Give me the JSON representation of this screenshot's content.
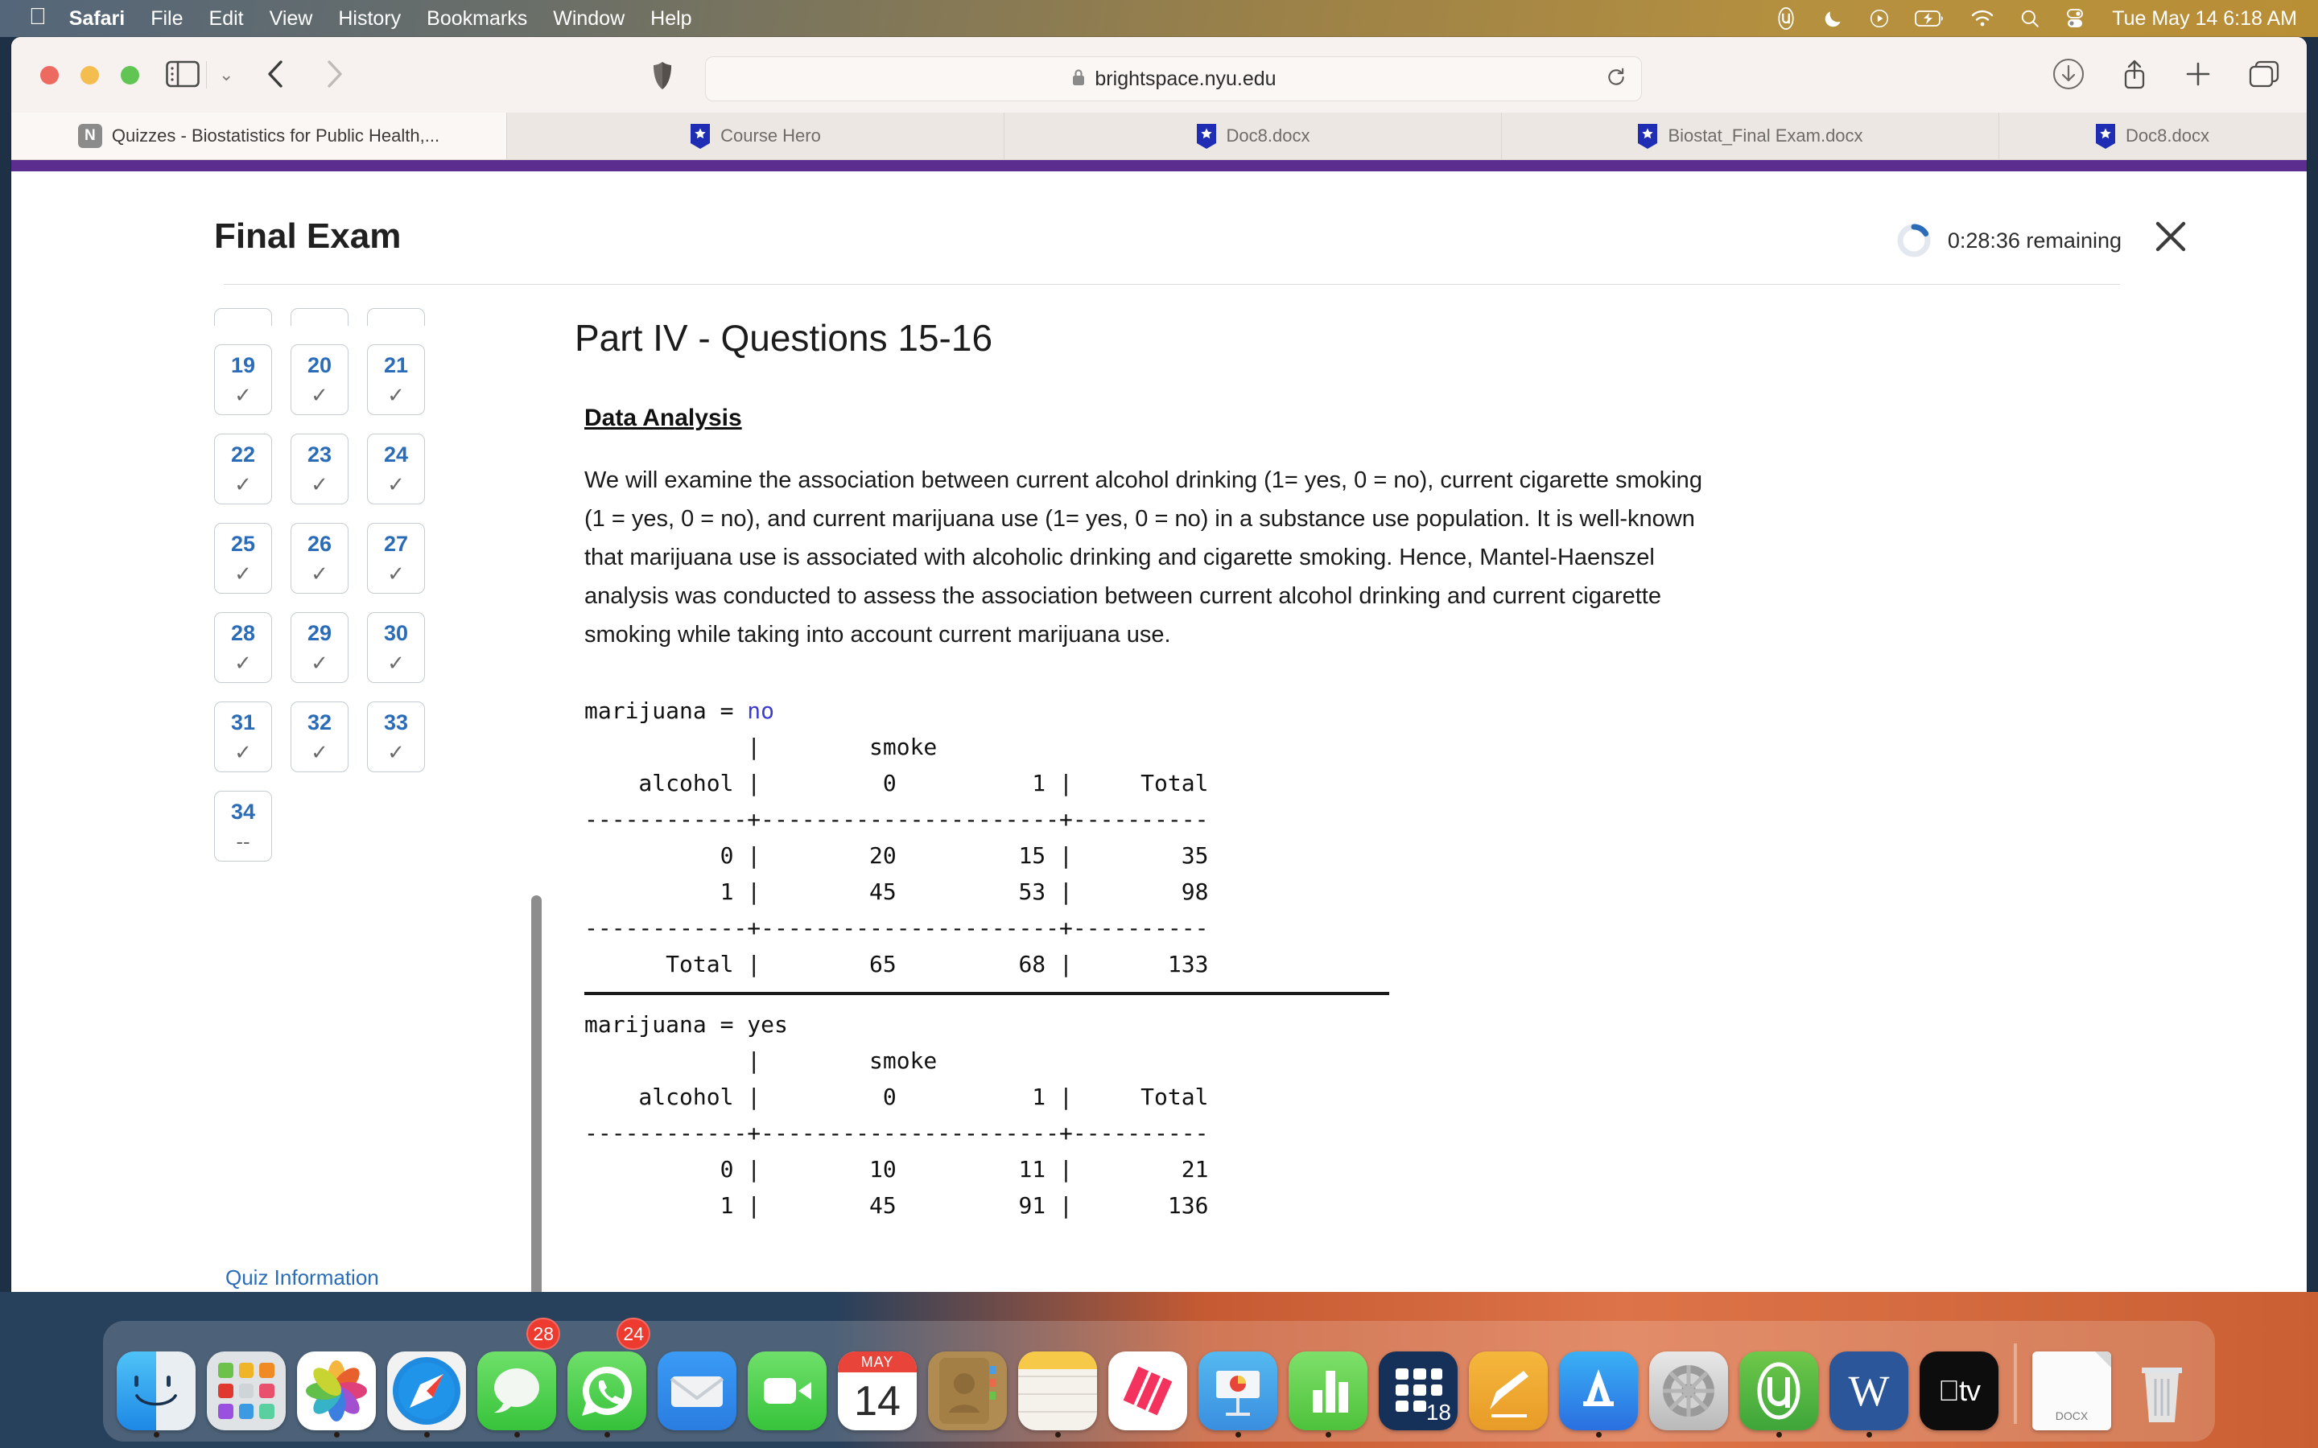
{
  "menubar": {
    "apple": "",
    "items": [
      "Safari",
      "File",
      "Edit",
      "View",
      "History",
      "Bookmarks",
      "Window",
      "Help"
    ],
    "status_icons": [
      "utorrent-icon",
      "moon-icon",
      "play-circle-icon",
      "battery-charging-icon",
      "wifi-icon",
      "search-icon",
      "control-center-icon"
    ],
    "clock": "Tue May 14  6:18 AM"
  },
  "browser": {
    "url": "brightspace.nyu.edu",
    "toolbar_icons": [
      "sidebar-icon",
      "chevron-down-icon",
      "back-icon",
      "forward-icon",
      "shield-icon",
      "lock-icon",
      "reload-icon",
      "download-icon",
      "share-icon",
      "new-tab-icon",
      "tab-overview-icon"
    ],
    "tabs": [
      {
        "label": "Quizzes - Biostatistics for Public Health,...",
        "favicon": "nyu-icon",
        "active": true
      },
      {
        "label": "Course Hero",
        "favicon": "coursehero-icon",
        "active": false
      },
      {
        "label": "Doc8.docx",
        "favicon": "coursehero-icon",
        "active": false
      },
      {
        "label": "Biostat_Final Exam.docx",
        "favicon": "coursehero-icon",
        "active": false
      },
      {
        "label": "Doc8.docx",
        "favicon": "coursehero-icon",
        "active": false
      }
    ]
  },
  "exam": {
    "title": "Final Exam",
    "timer_text": "0:28:36 remaining",
    "close_label": "✕",
    "quiz_information": "Quiz Information",
    "question_nav": [
      [
        {
          "num": "19",
          "state": "✓"
        },
        {
          "num": "20",
          "state": "✓"
        },
        {
          "num": "21",
          "state": "✓"
        }
      ],
      [
        {
          "num": "22",
          "state": "✓"
        },
        {
          "num": "23",
          "state": "✓"
        },
        {
          "num": "24",
          "state": "✓"
        }
      ],
      [
        {
          "num": "25",
          "state": "✓"
        },
        {
          "num": "26",
          "state": "✓"
        },
        {
          "num": "27",
          "state": "✓"
        }
      ],
      [
        {
          "num": "28",
          "state": "✓"
        },
        {
          "num": "29",
          "state": "✓"
        },
        {
          "num": "30",
          "state": "✓"
        }
      ],
      [
        {
          "num": "31",
          "state": "✓"
        },
        {
          "num": "32",
          "state": "✓"
        },
        {
          "num": "33",
          "state": "✓"
        }
      ],
      [
        {
          "num": "34",
          "state": "--"
        }
      ]
    ]
  },
  "question": {
    "part_title": "Part IV - Questions 15-16",
    "section_title": "Data Analysis",
    "paragraph": "We will examine the association between current alcohol drinking (1= yes, 0 = no), current cigarette smoking (1 = yes, 0 = no), and current marijuana use (1= yes, 0 = no) in a substance use population. It is well-known that marijuana use is associated with alcoholic drinking and cigarette smoking. Hence, Mantel-Haenszel analysis was conducted to assess the association between current alcohol drinking and current cigarette smoking while taking into account current marijuana use.",
    "output_block_1_label_prefix": "marijuana = ",
    "output_block_1_label_value": "no",
    "output_block_1": "            |        smoke\n    alcohol |         0          1 |     Total\n------------+----------------------+----------\n          0 |        20         15 |        35\n          1 |        45         53 |        98\n------------+----------------------+----------\n      Total |        65         68 |       133",
    "output_block_2_label_prefix": "marijuana = ",
    "output_block_2_label_value": "yes",
    "output_block_2": "            |        smoke\n    alcohol |         0          1 |     Total\n------------+----------------------+----------\n          0 |        10         11 |        21\n          1 |        45         91 |       136"
  },
  "chart_data": {
    "type": "table",
    "title": "Mantel-Haenszel stratified 2x2 tables: alcohol by smoke, stratified by marijuana",
    "strata": [
      {
        "name": "marijuana = no",
        "row_var": "alcohol",
        "col_var": "smoke",
        "columns": [
          "0",
          "1",
          "Total"
        ],
        "rows": [
          {
            "label": "0",
            "values": [
              20,
              15,
              35
            ]
          },
          {
            "label": "1",
            "values": [
              45,
              53,
              98
            ]
          },
          {
            "label": "Total",
            "values": [
              65,
              68,
              133
            ]
          }
        ]
      },
      {
        "name": "marijuana = yes",
        "row_var": "alcohol",
        "col_var": "smoke",
        "columns": [
          "0",
          "1",
          "Total"
        ],
        "rows": [
          {
            "label": "0",
            "values": [
              10,
              11,
              21
            ]
          },
          {
            "label": "1",
            "values": [
              45,
              91,
              136
            ]
          }
        ]
      }
    ]
  },
  "dock": {
    "items": [
      {
        "name": "finder",
        "badge": "",
        "running": true
      },
      {
        "name": "launchpad",
        "badge": "",
        "running": false
      },
      {
        "name": "photos",
        "badge": "",
        "running": true
      },
      {
        "name": "safari",
        "badge": "",
        "running": true
      },
      {
        "name": "messages",
        "badge": "28",
        "running": true
      },
      {
        "name": "whatsapp",
        "badge": "24",
        "running": true
      },
      {
        "name": "mail",
        "badge": "",
        "running": false
      },
      {
        "name": "facetime",
        "badge": "",
        "running": false
      },
      {
        "name": "calendar",
        "badge": "",
        "running": false,
        "month": "MAY",
        "day": "14"
      },
      {
        "name": "contacts",
        "badge": "",
        "running": false
      },
      {
        "name": "notes",
        "badge": "",
        "running": true
      },
      {
        "name": "news",
        "badge": "",
        "running": false
      },
      {
        "name": "keynote",
        "badge": "",
        "running": false
      },
      {
        "name": "numbers",
        "badge": "",
        "running": true
      },
      {
        "name": "stata",
        "badge": "",
        "running": false,
        "label": "18"
      },
      {
        "name": "pages",
        "badge": "",
        "running": false
      },
      {
        "name": "app-store",
        "badge": "",
        "running": true
      },
      {
        "name": "system-settings",
        "badge": "",
        "running": false
      },
      {
        "name": "utorrent",
        "badge": "",
        "running": true
      },
      {
        "name": "word",
        "badge": "",
        "running": true
      },
      {
        "name": "apple-tv",
        "badge": "",
        "running": false
      },
      {
        "name": "docx-file",
        "badge": "",
        "running": false,
        "label": "DOCX"
      },
      {
        "name": "trash",
        "badge": "",
        "running": false
      }
    ]
  }
}
